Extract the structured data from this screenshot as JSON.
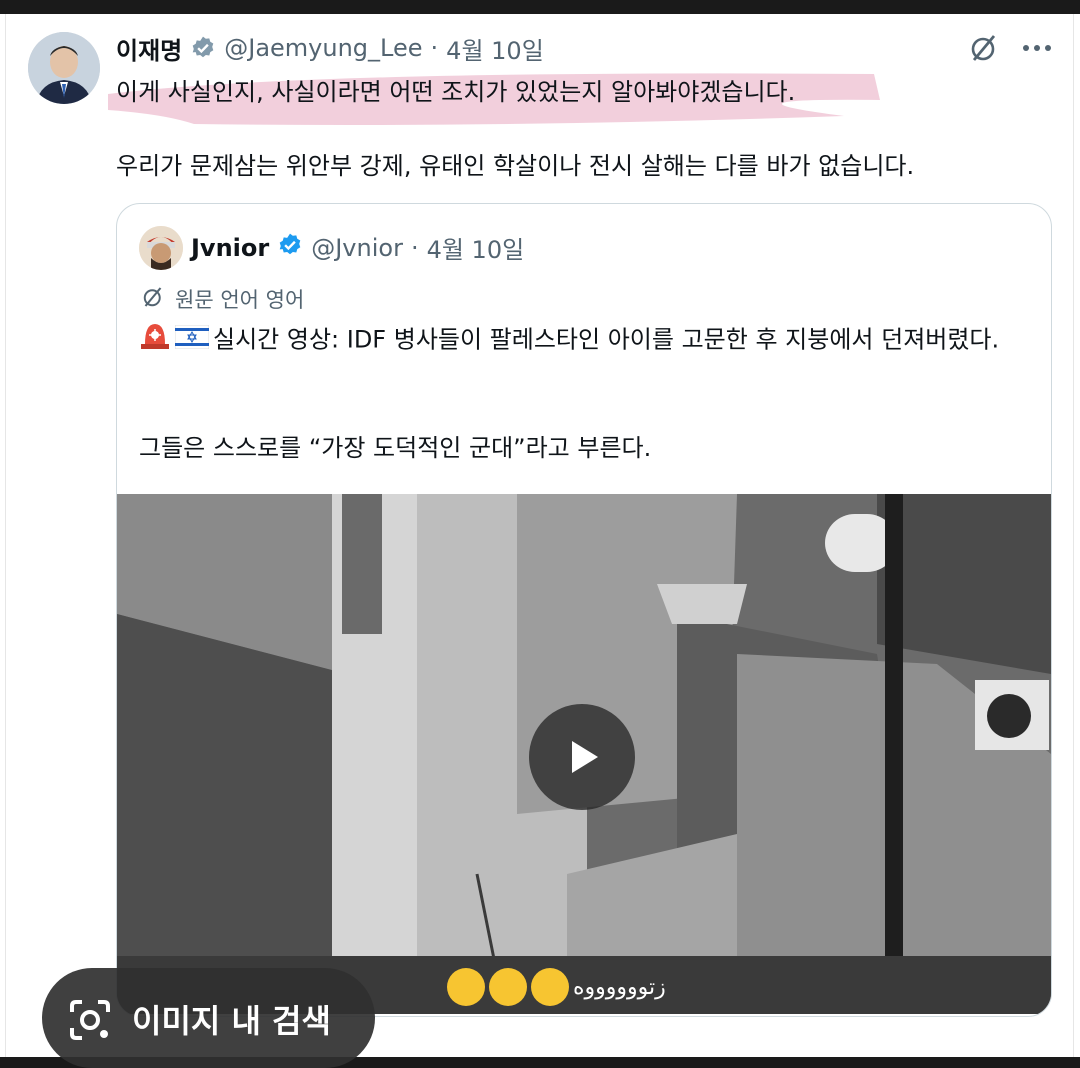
{
  "tweet": {
    "author_name": "이재명",
    "handle": "@Jaemyung_Lee",
    "date": "4월 10일",
    "separator": "·",
    "text_line1": "이게 사실인지, 사실이라면 어떤 조치가 있었는지 알아봐야겠습니다.",
    "text_line2": "우리가 문제삼는 위안부 강제, 유태인 학살이나 전시 살해는 다를 바가 없습니다.",
    "highlight_color": "#e8a8c0"
  },
  "quoted": {
    "author_name": "Jvnior",
    "handle": "@Jvnior",
    "date": "4월 10일",
    "separator": "·",
    "translate_label": "원문 언어 영어",
    "text_line1": "실시간 영상: IDF 병사들이 팔레스타인 아이를 고문한 후 지붕에서 던져버렸다.",
    "text_line2": "그들은 스스로를 “가장 도덕적인 군대”라고 부른다.",
    "video_caption": "زتووووووه"
  },
  "overlay": {
    "image_search_label": "이미지 내 검색"
  },
  "colors": {
    "verified_blue": "#1d9bf0",
    "verified_gray": "#829aab",
    "text": "#0f1419",
    "muted": "#536471"
  },
  "icons": [
    "verified-gray-icon",
    "grok-slash-icon",
    "more-icon",
    "verified-blue-icon",
    "translate-icon",
    "siren-icon",
    "israel-flag-icon",
    "play-icon",
    "lens-icon"
  ]
}
